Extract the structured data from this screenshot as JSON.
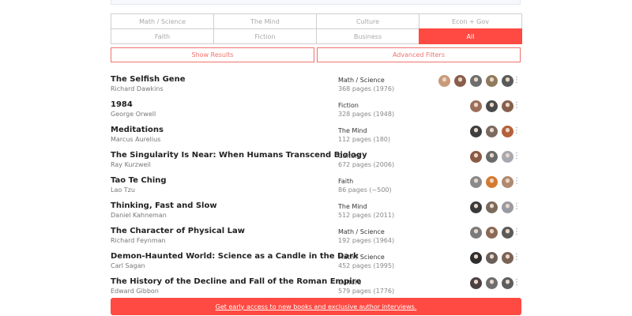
{
  "categories": [
    {
      "label": "Math / Science",
      "active": false
    },
    {
      "label": "The Mind",
      "active": false
    },
    {
      "label": "Culture",
      "active": false
    },
    {
      "label": "Econ + Gov",
      "active": false
    },
    {
      "label": "Faith",
      "active": false
    },
    {
      "label": "Fiction",
      "active": false
    },
    {
      "label": "Business",
      "active": false
    },
    {
      "label": "All",
      "active": true
    }
  ],
  "actions": {
    "show_results": "Show Results",
    "advanced_filters": "Advanced Filters"
  },
  "books": [
    {
      "title": "The Selfish Gene",
      "author": "Richard Dawkins",
      "category": "Math / Science",
      "pages": "368 pages (1976)",
      "avatars": [
        "#c89a78",
        "#8a5e4c",
        "#6e6e6e",
        "#8f7a5d",
        "#5a5a5a"
      ]
    },
    {
      "title": "1984",
      "author": "George Orwell",
      "category": "Fiction",
      "pages": "328 pages (1948)",
      "avatars": [
        "#9c6e5a",
        "#4a4a4a",
        "#86604a"
      ]
    },
    {
      "title": "Meditations",
      "author": "Marcus Aurelius",
      "category": "The Mind",
      "pages": "112 pages (180)",
      "avatars": [
        "#3e3e3e",
        "#7a6a62",
        "#b5603c"
      ]
    },
    {
      "title": "The Singularity Is Near: When Humans Transcend Biology",
      "author": "Ray Kurzweil",
      "category": "Culture",
      "pages": "672 pages (2006)",
      "avatars": [
        "#8a5a44",
        "#6a6a6a",
        "#a8a8b0"
      ]
    },
    {
      "title": "Tao Te Ching",
      "author": "Lao Tzu",
      "category": "Faith",
      "pages": "86 pages (~500)",
      "avatars": [
        "#8a8a8a",
        "#d47a30",
        "#b08a70"
      ]
    },
    {
      "title": "Thinking, Fast and Slow",
      "author": "Daniel Kahneman",
      "category": "The Mind",
      "pages": "512 pages (2011)",
      "avatars": [
        "#3a3a3a",
        "#7a6a5a",
        "#9a9aa2"
      ]
    },
    {
      "title": "The Character of Physical Law",
      "author": "Richard Feynman",
      "category": "Math / Science",
      "pages": "192 pages (1964)",
      "avatars": [
        "#7a7a7a",
        "#8a6a56",
        "#5a5a5a"
      ]
    },
    {
      "title": "Demon-Haunted World: Science as a Candle in the Dark",
      "author": "Carl Sagan",
      "category": "Math / Science",
      "pages": "452 pages (1995)",
      "avatars": [
        "#2e2e2e",
        "#6a5e58",
        "#7a6256"
      ]
    },
    {
      "title": "The History of the Decline and Fall of the Roman Empire",
      "author": "Edward Gibbon",
      "category": "Culture",
      "pages": "579 pages (1776)",
      "avatars": [
        "#4a4040",
        "#6e6e6e",
        "#5e5e5e"
      ]
    }
  ],
  "more_glyph": "⋮",
  "cta": {
    "text": "Get early access to new books and exclusive author interviews.",
    "color": "#ff4a43"
  }
}
